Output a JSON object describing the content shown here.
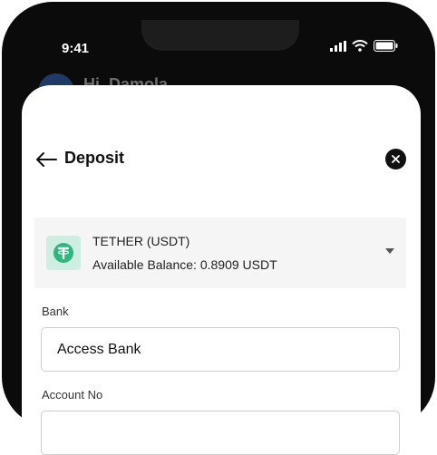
{
  "status_bar": {
    "time": "9:41"
  },
  "background": {
    "greeting": "Hi, Damola"
  },
  "header": {
    "title": "Deposit"
  },
  "asset": {
    "name": "TETHER (USDT)",
    "balance_text": "Available Balance: 0.8909 USDT",
    "icon": "tether-icon"
  },
  "form": {
    "bank_label": "Bank",
    "bank_value": "Access Bank",
    "account_label": "Account No",
    "account_value": ""
  },
  "colors": {
    "accent_green": "#2fb67c",
    "icon_bg": "#cdeee0",
    "phone_frame": "#0b0b0b"
  }
}
